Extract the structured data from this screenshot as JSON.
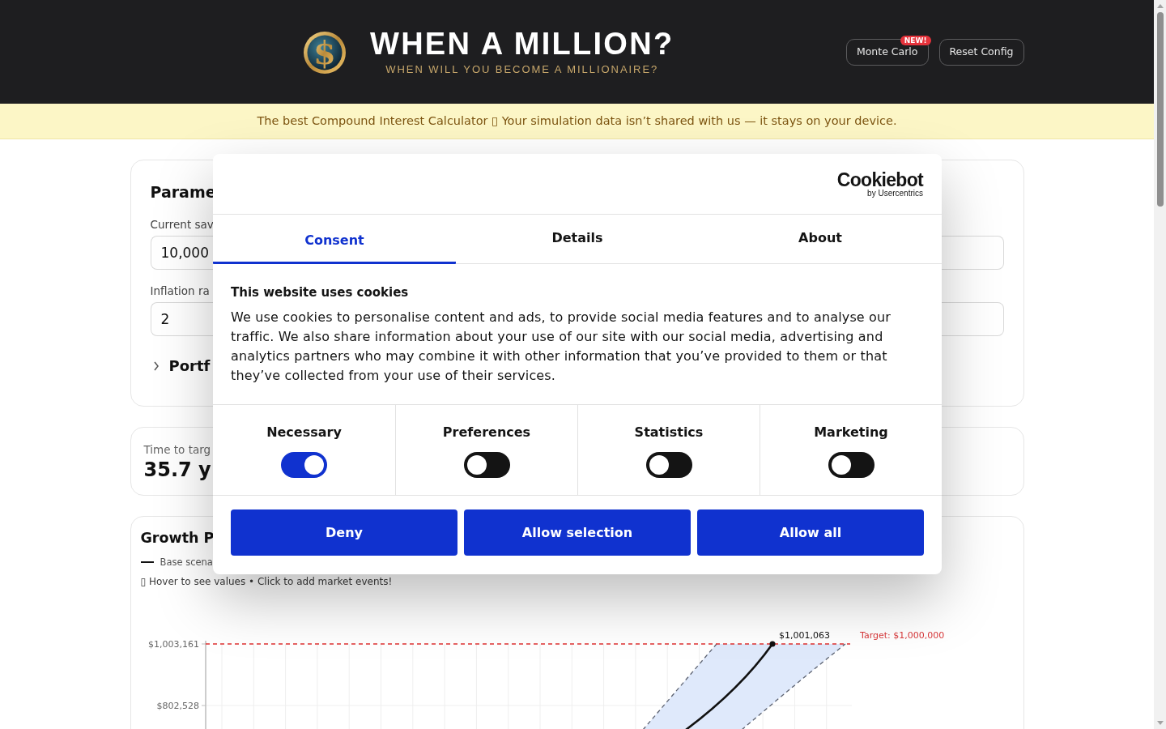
{
  "header": {
    "logo_glyph": "$",
    "title": "WHEN A MILLION?",
    "subtitle": "WHEN WILL YOU BECOME A MILLIONAIRE?",
    "buttons": [
      {
        "label": "Monte Carlo",
        "badge": "NEW!"
      },
      {
        "label": "Reset Config"
      }
    ]
  },
  "banner": {
    "text": "The best Compound Interest Calculator ▯ Your simulation data isn’t shared with us — it stays on your device."
  },
  "parameters": {
    "title": "Parame",
    "fields": [
      {
        "label": "Current sav",
        "value": "10,000"
      },
      {
        "label": "Inflation ra",
        "value": "2"
      }
    ],
    "section": {
      "label": "Portf",
      "expanded": false
    }
  },
  "summary": {
    "label": "Time to targ",
    "value": "35.7 y"
  },
  "growth": {
    "title": "Growth P",
    "legend": [
      {
        "label": "Base scena"
      }
    ],
    "hint": "▯ Hover to see values • Click to add market events!",
    "chart": {
      "y_tick_labels": [
        "$1,003,161",
        "$802,528"
      ],
      "point_label": "$1,001,063",
      "target_label": "Target: $1,000,000"
    }
  },
  "cookie_dialog": {
    "logo": {
      "wordmark": "Cookiebot",
      "byline": "by Usercentrics"
    },
    "tabs": [
      {
        "label": "Consent",
        "selected": true
      },
      {
        "label": "Details",
        "selected": false
      },
      {
        "label": "About",
        "selected": false
      }
    ],
    "heading": "This website uses cookies",
    "body": "We use cookies to personalise content and ads, to provide social media features and to analyse our traffic. We also share information about your use of our site with our social media, advertising and analytics partners who may combine it with other information that you’ve provided to them or that they’ve collected from your use of their services.",
    "categories": [
      {
        "label": "Necessary",
        "on": true
      },
      {
        "label": "Preferences",
        "on": false
      },
      {
        "label": "Statistics",
        "on": false
      },
      {
        "label": "Marketing",
        "on": false
      }
    ],
    "buttons": [
      "Deny",
      "Allow selection",
      "Allow all"
    ]
  }
}
